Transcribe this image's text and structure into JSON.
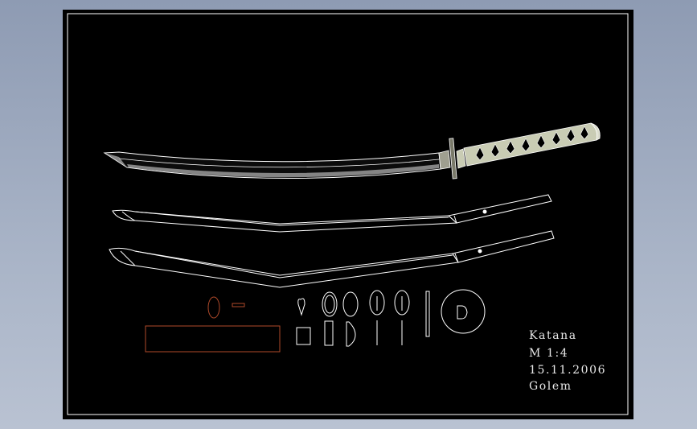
{
  "title_block": {
    "name": "Katana",
    "scale": "M 1:4",
    "date": "15.11.2006",
    "author": "Golem"
  },
  "colors": {
    "background": "#000000",
    "line": "#ffffff",
    "handle_fill": "#c9ccb4",
    "guard_fill": "#7a7a6a",
    "accent_red": "#b04a2a",
    "page_gradient": "#9aa6bd"
  },
  "icons": {
    "katana": "katana-drawing",
    "saya_upper": "scabbard-outline",
    "saya_lower": "scabbard-outline",
    "fittings": "fittings-parts"
  }
}
